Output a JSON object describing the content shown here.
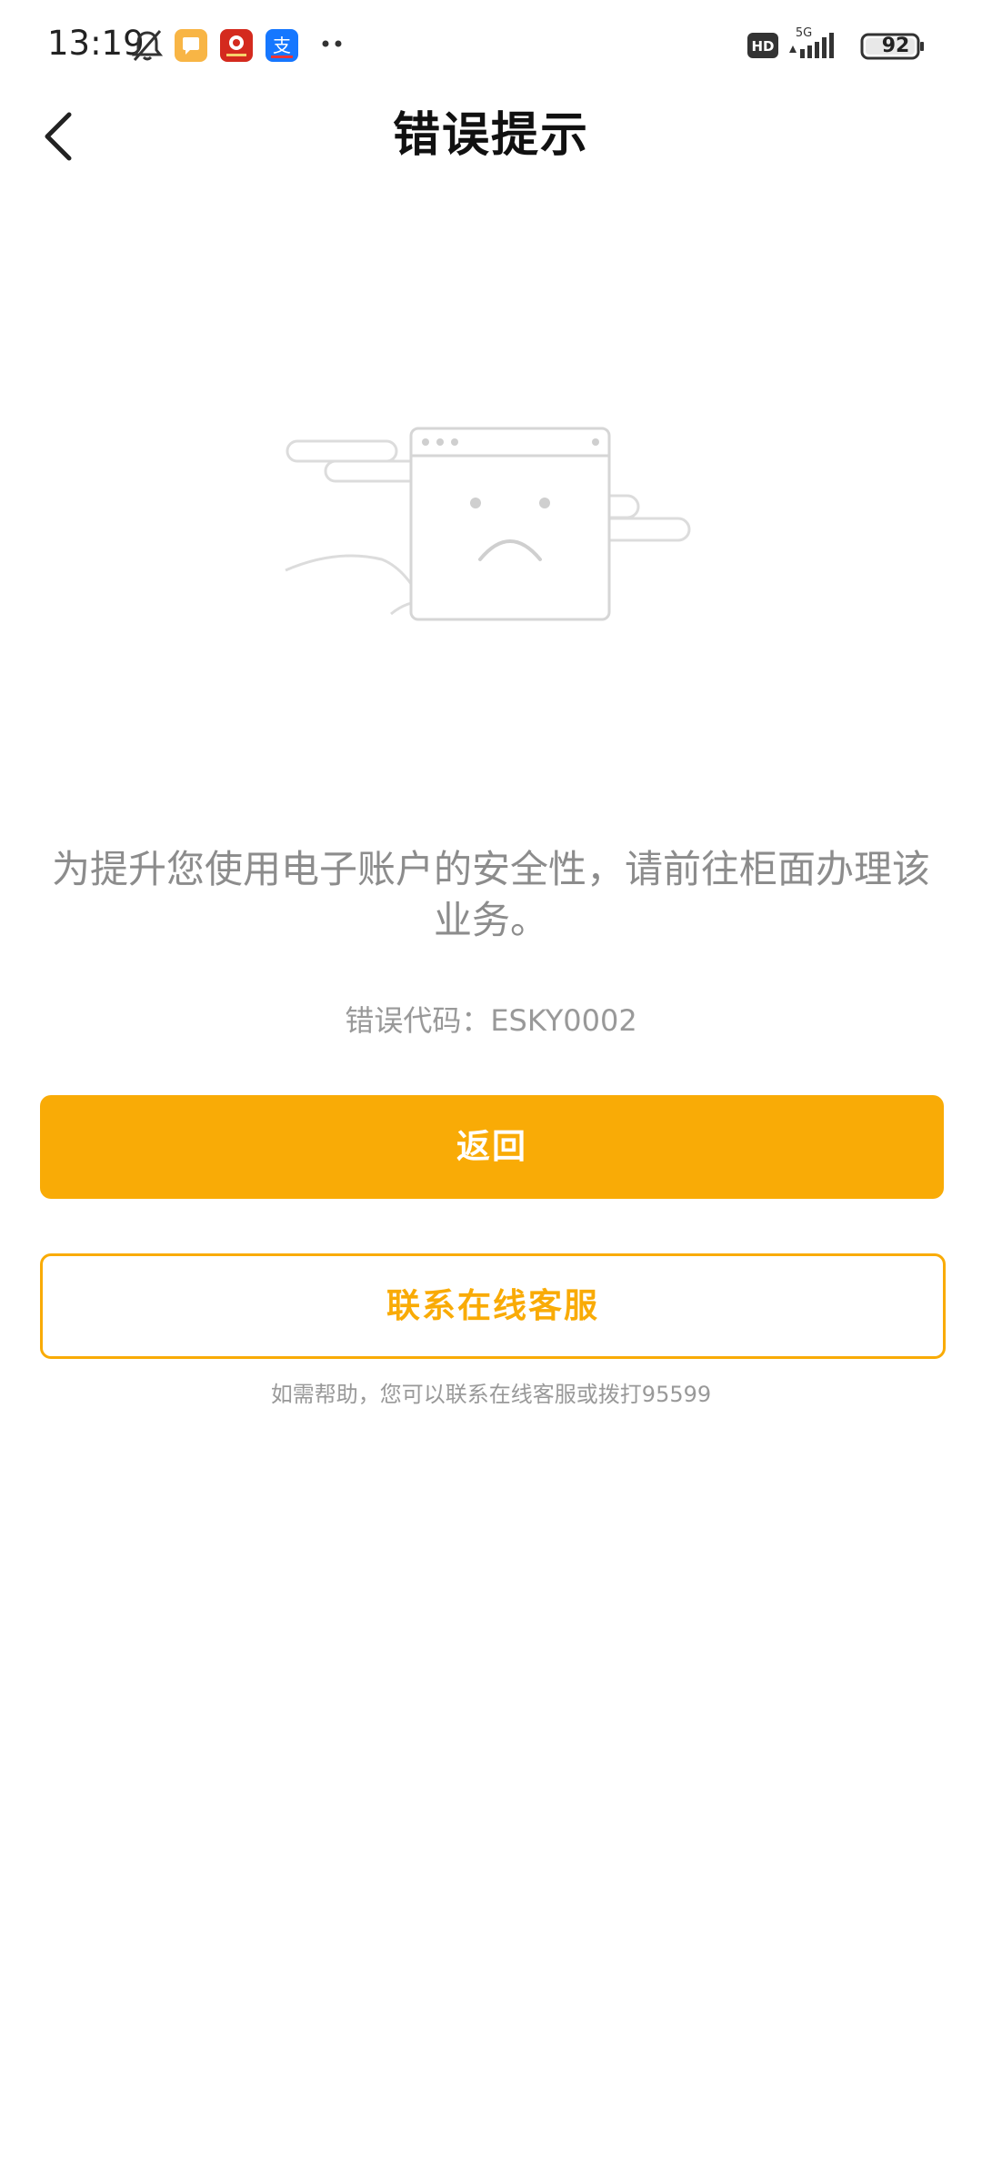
{
  "status_bar": {
    "time": "13:19",
    "network": "5G",
    "hd": "HD",
    "battery": "92"
  },
  "nav": {
    "title": "错误提示"
  },
  "content": {
    "message": "为提升您使用电子账户的安全性，请前往柜面办理该业务。",
    "error_code": "错误代码：ESKY0002"
  },
  "actions": {
    "back_label": "返回",
    "contact_label": "联系在线客服",
    "help_text": "如需帮助，您可以联系在线客服或拨打95599"
  },
  "colors": {
    "accent": "#f9ab06",
    "text_muted": "#8c8c8c"
  }
}
